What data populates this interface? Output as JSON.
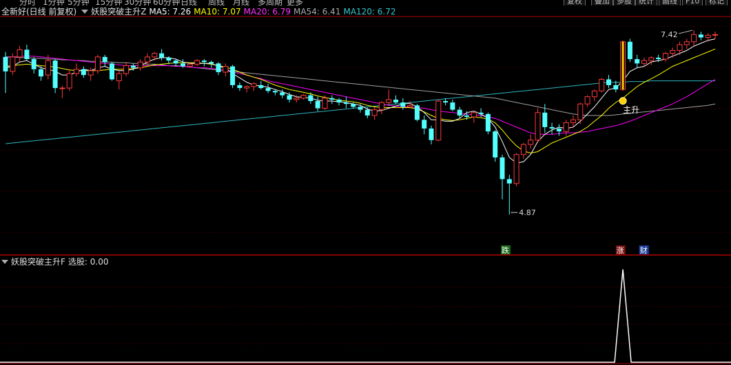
{
  "topbar": {
    "timeframes": [
      "分时",
      "1分钟",
      "5分钟",
      "15分钟",
      "30分钟",
      "60分钟",
      "日线",
      "周线",
      "月线",
      "多周期",
      "更多"
    ],
    "buttons": [
      "复权",
      "叠加",
      "多股",
      "统计",
      "画线",
      "F10",
      "标记"
    ]
  },
  "main_legend": {
    "stock": "全新好(日线 前复权)",
    "indicator": "妖股突破主升Z",
    "ma5": "MA5: 7.26",
    "ma10": "MA10: 7.07",
    "ma20": "MA20: 6.79",
    "ma54": "MA54: 6.41",
    "ma120": "MA120: 6.72"
  },
  "colors": {
    "up": "#ff3c3c",
    "down": "#54ffff",
    "ma5": "#ffffff",
    "ma10": "#ffff00",
    "ma20": "#ff00ff",
    "ma54": "#a0a0a0",
    "ma120": "#2fb8c0",
    "divider": "#b00000",
    "grid": "#6a0000"
  },
  "annotations": {
    "high": "7.42",
    "low": "4.87",
    "signal_label": "主升",
    "marker_fall": "跌",
    "marker_rise": "涨",
    "marker_fin": "财"
  },
  "sub_legend": {
    "indicator": "妖股突破主升F",
    "value": "选股: 0.00"
  },
  "chart_data": {
    "type": "candlestick",
    "y_range": [
      4.7,
      7.6
    ],
    "candles": [
      [
        7.05,
        7.12,
        6.55,
        6.85
      ],
      [
        6.85,
        7.1,
        6.8,
        7.05
      ],
      [
        7.05,
        7.2,
        6.98,
        7.15
      ],
      [
        7.15,
        7.22,
        7.0,
        7.02
      ],
      [
        7.02,
        7.05,
        6.82,
        6.88
      ],
      [
        6.88,
        6.92,
        6.72,
        6.78
      ],
      [
        6.8,
        7.08,
        6.74,
        7.0
      ],
      [
        7.0,
        7.02,
        6.55,
        6.62
      ],
      [
        6.62,
        6.65,
        6.48,
        6.62
      ],
      [
        6.62,
        6.86,
        6.58,
        6.82
      ],
      [
        6.82,
        6.96,
        6.78,
        6.88
      ],
      [
        6.88,
        6.92,
        6.76,
        6.8
      ],
      [
        6.8,
        6.9,
        6.72,
        6.86
      ],
      [
        6.86,
        7.08,
        6.82,
        7.05
      ],
      [
        7.05,
        7.08,
        6.92,
        6.98
      ],
      [
        6.96,
        6.98,
        6.72,
        6.74
      ],
      [
        6.72,
        6.86,
        6.6,
        6.82
      ],
      [
        6.82,
        6.98,
        6.78,
        6.93
      ],
      [
        6.93,
        6.96,
        6.86,
        6.9
      ],
      [
        6.9,
        7.02,
        6.86,
        6.98
      ],
      [
        6.98,
        7.1,
        6.92,
        7.05
      ],
      [
        7.05,
        7.12,
        7.0,
        7.1
      ],
      [
        7.1,
        7.16,
        7.0,
        7.04
      ],
      [
        7.04,
        7.06,
        6.95,
        7.0
      ],
      [
        7.0,
        7.02,
        6.92,
        6.96
      ],
      [
        6.96,
        7.02,
        6.9,
        6.92
      ],
      [
        6.92,
        6.98,
        6.9,
        6.95
      ],
      [
        6.95,
        7.02,
        6.92,
        7.0
      ],
      [
        7.0,
        7.02,
        6.92,
        6.98
      ],
      [
        6.98,
        7.0,
        6.9,
        6.96
      ],
      [
        6.96,
        6.98,
        6.8,
        6.84
      ],
      [
        6.84,
        6.96,
        6.78,
        6.92
      ],
      [
        6.92,
        6.94,
        6.62,
        6.66
      ],
      [
        6.66,
        6.7,
        6.58,
        6.62
      ],
      [
        6.62,
        6.66,
        6.56,
        6.64
      ],
      [
        6.64,
        6.7,
        6.58,
        6.68
      ],
      [
        6.66,
        6.72,
        6.6,
        6.62
      ],
      [
        6.62,
        6.68,
        6.55,
        6.58
      ],
      [
        6.58,
        6.6,
        6.52,
        6.56
      ],
      [
        6.56,
        6.6,
        6.48,
        6.52
      ],
      [
        6.52,
        6.56,
        6.42,
        6.46
      ],
      [
        6.46,
        6.52,
        6.42,
        6.48
      ],
      [
        6.48,
        6.54,
        6.46,
        6.52
      ],
      [
        6.52,
        6.56,
        6.4,
        6.44
      ],
      [
        6.44,
        6.5,
        6.3,
        6.34
      ],
      [
        6.34,
        6.52,
        6.32,
        6.48
      ],
      [
        6.48,
        6.52,
        6.4,
        6.46
      ],
      [
        6.46,
        6.48,
        6.38,
        6.42
      ],
      [
        6.42,
        6.5,
        6.34,
        6.4
      ],
      [
        6.4,
        6.42,
        6.34,
        6.36
      ],
      [
        6.36,
        6.4,
        6.28,
        6.32
      ],
      [
        6.32,
        6.35,
        6.2,
        6.24
      ],
      [
        6.24,
        6.36,
        6.18,
        6.32
      ],
      [
        6.32,
        6.44,
        6.26,
        6.42
      ],
      [
        6.42,
        6.6,
        6.38,
        6.46
      ],
      [
        6.46,
        6.52,
        6.4,
        6.42
      ],
      [
        6.42,
        6.48,
        6.32,
        6.36
      ],
      [
        6.36,
        6.44,
        6.34,
        6.38
      ],
      [
        6.38,
        6.4,
        6.16,
        6.18
      ],
      [
        6.18,
        6.24,
        5.98,
        6.06
      ],
      [
        6.06,
        6.1,
        5.84,
        5.9
      ],
      [
        5.9,
        6.46,
        5.88,
        6.44
      ],
      [
        6.44,
        6.48,
        6.38,
        6.42
      ],
      [
        6.42,
        6.46,
        6.3,
        6.32
      ],
      [
        6.32,
        6.36,
        6.2,
        6.24
      ],
      [
        6.24,
        6.3,
        6.18,
        6.22
      ],
      [
        6.22,
        6.3,
        6.14,
        6.28
      ],
      [
        6.28,
        6.34,
        6.22,
        6.26
      ],
      [
        6.26,
        6.28,
        5.98,
        6.02
      ],
      [
        6.02,
        6.04,
        5.6,
        5.66
      ],
      [
        5.66,
        5.7,
        5.08,
        5.36
      ],
      [
        5.36,
        5.42,
        4.87,
        5.3
      ],
      [
        5.3,
        5.72,
        5.26,
        5.7
      ],
      [
        5.7,
        5.86,
        5.64,
        5.84
      ],
      [
        5.84,
        5.98,
        5.78,
        5.9
      ],
      [
        5.9,
        6.34,
        5.86,
        6.28
      ],
      [
        6.28,
        6.4,
        6.0,
        6.08
      ],
      [
        6.08,
        6.14,
        5.98,
        6.06
      ],
      [
        6.06,
        6.12,
        5.96,
        6.02
      ],
      [
        6.02,
        6.18,
        5.96,
        6.14
      ],
      [
        6.14,
        6.24,
        6.08,
        6.18
      ],
      [
        6.18,
        6.42,
        6.12,
        6.4
      ],
      [
        6.4,
        6.52,
        6.36,
        6.5
      ],
      [
        6.5,
        6.6,
        6.44,
        6.58
      ],
      [
        6.58,
        6.76,
        6.56,
        6.74
      ],
      [
        6.74,
        6.8,
        6.62,
        6.66
      ],
      [
        6.66,
        6.72,
        6.56,
        6.6
      ],
      [
        6.6,
        7.28,
        6.58,
        7.26
      ],
      [
        7.26,
        7.3,
        6.98,
        7.02
      ],
      [
        7.02,
        7.08,
        6.9,
        6.96
      ],
      [
        6.96,
        7.04,
        6.92,
        7.0
      ],
      [
        7.0,
        7.06,
        6.94,
        7.04
      ],
      [
        7.04,
        7.08,
        6.98,
        7.02
      ],
      [
        7.02,
        7.12,
        6.98,
        7.1
      ],
      [
        7.1,
        7.18,
        7.04,
        7.14
      ],
      [
        7.14,
        7.26,
        7.08,
        7.22
      ],
      [
        7.22,
        7.3,
        7.16,
        7.26
      ],
      [
        7.26,
        7.42,
        7.2,
        7.36
      ],
      [
        7.36,
        7.4,
        7.28,
        7.32
      ],
      [
        7.32,
        7.38,
        7.26,
        7.35
      ],
      [
        7.35,
        7.4,
        7.3,
        7.36
      ]
    ],
    "ma5": [
      6.9,
      6.92,
      6.98,
      7.0,
      6.95,
      6.9,
      6.88,
      6.85,
      6.8,
      6.8,
      6.84,
      6.88,
      6.86,
      6.9,
      6.92,
      6.88,
      6.86,
      6.86,
      6.88,
      6.92,
      6.98,
      7.02,
      7.04,
      7.04,
      7.02,
      6.98,
      6.96,
      6.96,
      6.96,
      6.96,
      6.92,
      6.9,
      6.82,
      6.76,
      6.7,
      6.66,
      6.65,
      6.63,
      6.6,
      6.57,
      6.53,
      6.5,
      6.49,
      6.48,
      6.45,
      6.44,
      6.44,
      6.43,
      6.42,
      6.4,
      6.38,
      6.33,
      6.3,
      6.31,
      6.34,
      6.37,
      6.4,
      6.41,
      6.36,
      6.28,
      6.18,
      6.18,
      6.16,
      6.16,
      6.2,
      6.28,
      6.3,
      6.26,
      6.2,
      6.08,
      5.88,
      5.66,
      5.58,
      5.6,
      5.7,
      5.88,
      5.98,
      6.04,
      6.08,
      6.06,
      6.08,
      6.16,
      6.26,
      6.36,
      6.48,
      6.6,
      6.62,
      6.72,
      6.85,
      6.9,
      6.92,
      6.98,
      7.0,
      7.02,
      7.06,
      7.1,
      7.14,
      7.2,
      7.24,
      7.28,
      7.3
    ],
    "ma10": [
      6.92,
      6.93,
      6.94,
      6.95,
      6.94,
      6.93,
      6.92,
      6.91,
      6.89,
      6.87,
      6.86,
      6.86,
      6.86,
      6.86,
      6.87,
      6.88,
      6.88,
      6.88,
      6.89,
      6.9,
      6.92,
      6.94,
      6.95,
      6.96,
      6.97,
      6.97,
      6.97,
      6.97,
      6.96,
      6.95,
      6.93,
      6.91,
      6.88,
      6.84,
      6.8,
      6.77,
      6.74,
      6.7,
      6.66,
      6.63,
      6.6,
      6.58,
      6.56,
      6.54,
      6.51,
      6.49,
      6.47,
      6.45,
      6.44,
      6.43,
      6.41,
      6.38,
      6.36,
      6.35,
      6.35,
      6.35,
      6.35,
      6.35,
      6.33,
      6.29,
      6.24,
      6.2,
      6.18,
      6.17,
      6.18,
      6.2,
      6.22,
      6.21,
      6.19,
      6.14,
      6.04,
      5.92,
      5.82,
      5.75,
      5.72,
      5.74,
      5.8,
      5.86,
      5.9,
      5.94,
      5.98,
      6.02,
      6.08,
      6.16,
      6.24,
      6.34,
      6.42,
      6.48,
      6.56,
      6.64,
      6.7,
      6.75,
      6.8,
      6.86,
      6.92,
      6.96,
      7.0,
      7.04,
      7.08,
      7.12,
      7.16
    ],
    "ma20": [
      7.04,
      7.05,
      7.06,
      7.06,
      7.06,
      7.05,
      7.04,
      7.03,
      7.02,
      7.01,
      7.0,
      6.99,
      6.98,
      6.97,
      6.96,
      6.95,
      6.94,
      6.93,
      6.93,
      6.93,
      6.93,
      6.93,
      6.93,
      6.93,
      6.92,
      6.92,
      6.91,
      6.9,
      6.9,
      6.89,
      6.88,
      6.86,
      6.84,
      6.82,
      6.8,
      6.77,
      6.75,
      6.72,
      6.7,
      6.68,
      6.66,
      6.64,
      6.62,
      6.6,
      6.58,
      6.56,
      6.54,
      6.52,
      6.5,
      6.48,
      6.46,
      6.44,
      6.42,
      6.4,
      6.38,
      6.37,
      6.36,
      6.36,
      6.35,
      6.34,
      6.32,
      6.3,
      6.29,
      6.28,
      6.27,
      6.26,
      6.25,
      6.24,
      6.22,
      6.2,
      6.16,
      6.12,
      6.08,
      6.04,
      6.0,
      5.98,
      5.98,
      5.98,
      5.99,
      6.0,
      6.0,
      6.01,
      6.02,
      6.04,
      6.06,
      6.08,
      6.1,
      6.13,
      6.16,
      6.2,
      6.24,
      6.28,
      6.32,
      6.36,
      6.4,
      6.45,
      6.5,
      6.56,
      6.62,
      6.68,
      6.74
    ],
    "ma54": [
      7.05,
      7.05,
      7.04,
      7.04,
      7.03,
      7.03,
      7.02,
      7.02,
      7.01,
      7.01,
      7.0,
      7.0,
      6.99,
      6.99,
      6.98,
      6.98,
      6.97,
      6.97,
      6.96,
      6.96,
      6.95,
      6.95,
      6.94,
      6.93,
      6.93,
      6.92,
      6.91,
      6.9,
      6.89,
      6.88,
      6.87,
      6.86,
      6.85,
      6.84,
      6.83,
      6.82,
      6.81,
      6.8,
      6.79,
      6.78,
      6.77,
      6.76,
      6.75,
      6.74,
      6.73,
      6.72,
      6.71,
      6.7,
      6.69,
      6.68,
      6.67,
      6.66,
      6.65,
      6.64,
      6.63,
      6.62,
      6.61,
      6.6,
      6.59,
      6.58,
      6.57,
      6.56,
      6.55,
      6.54,
      6.53,
      6.52,
      6.51,
      6.5,
      6.49,
      6.48,
      6.46,
      6.44,
      6.42,
      6.4,
      6.38,
      6.36,
      6.34,
      6.32,
      6.3,
      6.28,
      6.26,
      6.25,
      6.24,
      6.24,
      6.24,
      6.24,
      6.25,
      6.26,
      6.27,
      6.28,
      6.29,
      6.3,
      6.31,
      6.32,
      6.33,
      6.34,
      6.35,
      6.36,
      6.37,
      6.38,
      6.4
    ],
    "ma120": [
      5.85,
      5.86,
      5.87,
      5.88,
      5.89,
      5.9,
      5.91,
      5.92,
      5.93,
      5.94,
      5.95,
      5.96,
      5.97,
      5.98,
      5.99,
      6.0,
      6.01,
      6.02,
      6.03,
      6.04,
      6.05,
      6.06,
      6.07,
      6.08,
      6.09,
      6.1,
      6.11,
      6.12,
      6.13,
      6.14,
      6.15,
      6.16,
      6.17,
      6.18,
      6.19,
      6.2,
      6.21,
      6.22,
      6.23,
      6.24,
      6.25,
      6.26,
      6.27,
      6.28,
      6.29,
      6.3,
      6.31,
      6.32,
      6.33,
      6.34,
      6.35,
      6.36,
      6.37,
      6.38,
      6.39,
      6.4,
      6.41,
      6.42,
      6.43,
      6.44,
      6.45,
      6.46,
      6.47,
      6.48,
      6.49,
      6.5,
      6.51,
      6.52,
      6.53,
      6.54,
      6.55,
      6.56,
      6.57,
      6.58,
      6.59,
      6.6,
      6.61,
      6.62,
      6.63,
      6.64,
      6.65,
      6.66,
      6.67,
      6.68,
      6.69,
      6.7,
      6.7,
      6.7,
      6.71,
      6.71,
      6.71,
      6.72,
      6.72,
      6.72,
      6.72,
      6.72,
      6.72,
      6.72,
      6.72,
      6.72,
      6.72
    ],
    "signal_index": 87,
    "sub_series": {
      "name": "选股",
      "peak_index": 87,
      "peak_value": 1,
      "y_range": [
        0,
        1
      ]
    }
  }
}
